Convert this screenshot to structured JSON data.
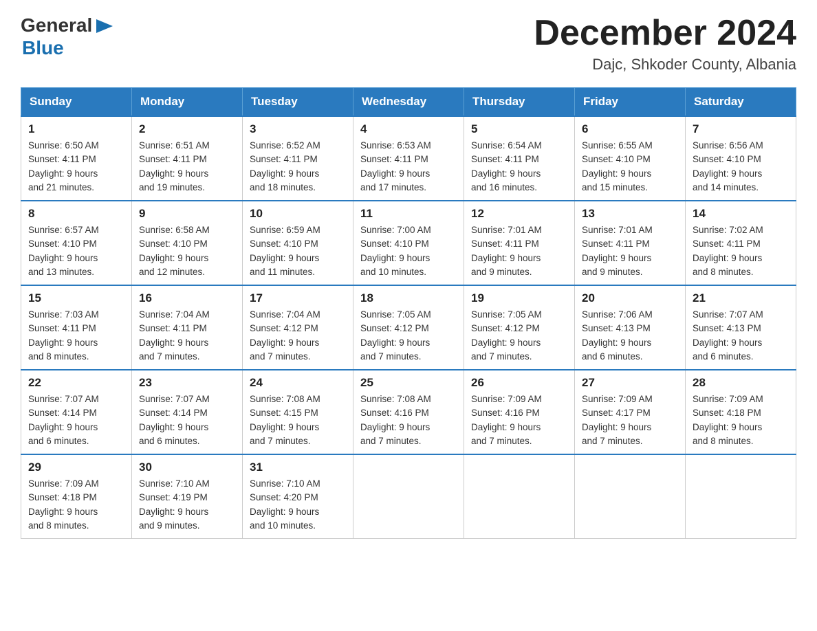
{
  "header": {
    "logo": {
      "general": "General",
      "blue": "Blue",
      "arrow_icon": "▶"
    },
    "title": "December 2024",
    "location": "Dajc, Shkoder County, Albania"
  },
  "calendar": {
    "days_of_week": [
      "Sunday",
      "Monday",
      "Tuesday",
      "Wednesday",
      "Thursday",
      "Friday",
      "Saturday"
    ],
    "weeks": [
      [
        {
          "day": "1",
          "sunrise": "6:50 AM",
          "sunset": "4:11 PM",
          "daylight": "9 hours and 21 minutes."
        },
        {
          "day": "2",
          "sunrise": "6:51 AM",
          "sunset": "4:11 PM",
          "daylight": "9 hours and 19 minutes."
        },
        {
          "day": "3",
          "sunrise": "6:52 AM",
          "sunset": "4:11 PM",
          "daylight": "9 hours and 18 minutes."
        },
        {
          "day": "4",
          "sunrise": "6:53 AM",
          "sunset": "4:11 PM",
          "daylight": "9 hours and 17 minutes."
        },
        {
          "day": "5",
          "sunrise": "6:54 AM",
          "sunset": "4:11 PM",
          "daylight": "9 hours and 16 minutes."
        },
        {
          "day": "6",
          "sunrise": "6:55 AM",
          "sunset": "4:10 PM",
          "daylight": "9 hours and 15 minutes."
        },
        {
          "day": "7",
          "sunrise": "6:56 AM",
          "sunset": "4:10 PM",
          "daylight": "9 hours and 14 minutes."
        }
      ],
      [
        {
          "day": "8",
          "sunrise": "6:57 AM",
          "sunset": "4:10 PM",
          "daylight": "9 hours and 13 minutes."
        },
        {
          "day": "9",
          "sunrise": "6:58 AM",
          "sunset": "4:10 PM",
          "daylight": "9 hours and 12 minutes."
        },
        {
          "day": "10",
          "sunrise": "6:59 AM",
          "sunset": "4:10 PM",
          "daylight": "9 hours and 11 minutes."
        },
        {
          "day": "11",
          "sunrise": "7:00 AM",
          "sunset": "4:10 PM",
          "daylight": "9 hours and 10 minutes."
        },
        {
          "day": "12",
          "sunrise": "7:01 AM",
          "sunset": "4:11 PM",
          "daylight": "9 hours and 9 minutes."
        },
        {
          "day": "13",
          "sunrise": "7:01 AM",
          "sunset": "4:11 PM",
          "daylight": "9 hours and 9 minutes."
        },
        {
          "day": "14",
          "sunrise": "7:02 AM",
          "sunset": "4:11 PM",
          "daylight": "9 hours and 8 minutes."
        }
      ],
      [
        {
          "day": "15",
          "sunrise": "7:03 AM",
          "sunset": "4:11 PM",
          "daylight": "9 hours and 8 minutes."
        },
        {
          "day": "16",
          "sunrise": "7:04 AM",
          "sunset": "4:11 PM",
          "daylight": "9 hours and 7 minutes."
        },
        {
          "day": "17",
          "sunrise": "7:04 AM",
          "sunset": "4:12 PM",
          "daylight": "9 hours and 7 minutes."
        },
        {
          "day": "18",
          "sunrise": "7:05 AM",
          "sunset": "4:12 PM",
          "daylight": "9 hours and 7 minutes."
        },
        {
          "day": "19",
          "sunrise": "7:05 AM",
          "sunset": "4:12 PM",
          "daylight": "9 hours and 7 minutes."
        },
        {
          "day": "20",
          "sunrise": "7:06 AM",
          "sunset": "4:13 PM",
          "daylight": "9 hours and 6 minutes."
        },
        {
          "day": "21",
          "sunrise": "7:07 AM",
          "sunset": "4:13 PM",
          "daylight": "9 hours and 6 minutes."
        }
      ],
      [
        {
          "day": "22",
          "sunrise": "7:07 AM",
          "sunset": "4:14 PM",
          "daylight": "9 hours and 6 minutes."
        },
        {
          "day": "23",
          "sunrise": "7:07 AM",
          "sunset": "4:14 PM",
          "daylight": "9 hours and 6 minutes."
        },
        {
          "day": "24",
          "sunrise": "7:08 AM",
          "sunset": "4:15 PM",
          "daylight": "9 hours and 7 minutes."
        },
        {
          "day": "25",
          "sunrise": "7:08 AM",
          "sunset": "4:16 PM",
          "daylight": "9 hours and 7 minutes."
        },
        {
          "day": "26",
          "sunrise": "7:09 AM",
          "sunset": "4:16 PM",
          "daylight": "9 hours and 7 minutes."
        },
        {
          "day": "27",
          "sunrise": "7:09 AM",
          "sunset": "4:17 PM",
          "daylight": "9 hours and 7 minutes."
        },
        {
          "day": "28",
          "sunrise": "7:09 AM",
          "sunset": "4:18 PM",
          "daylight": "9 hours and 8 minutes."
        }
      ],
      [
        {
          "day": "29",
          "sunrise": "7:09 AM",
          "sunset": "4:18 PM",
          "daylight": "9 hours and 8 minutes."
        },
        {
          "day": "30",
          "sunrise": "7:10 AM",
          "sunset": "4:19 PM",
          "daylight": "9 hours and 9 minutes."
        },
        {
          "day": "31",
          "sunrise": "7:10 AM",
          "sunset": "4:20 PM",
          "daylight": "9 hours and 10 minutes."
        },
        null,
        null,
        null,
        null
      ]
    ],
    "labels": {
      "sunrise": "Sunrise:",
      "sunset": "Sunset:",
      "daylight": "Daylight:"
    }
  }
}
